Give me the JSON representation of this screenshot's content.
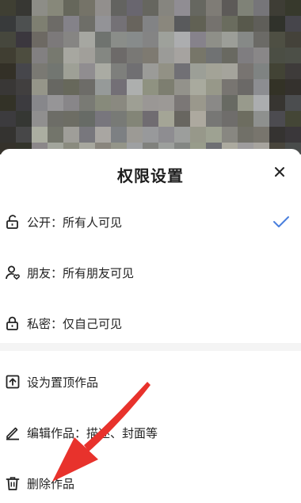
{
  "sheet": {
    "title": "权限设置"
  },
  "visibility_options": [
    {
      "label": "公开：所有人可见",
      "icon": "unlock-icon",
      "selected": true
    },
    {
      "label": "朋友：所有朋友可见",
      "icon": "friends-icon",
      "selected": false
    },
    {
      "label": "私密：仅自己可见",
      "icon": "lock-icon",
      "selected": false
    }
  ],
  "actions": [
    {
      "label": "设为置顶作品",
      "icon": "pin-top-icon"
    },
    {
      "label": "编辑作品：描述、封面等",
      "icon": "edit-pen-icon"
    },
    {
      "label": "删除作品",
      "icon": "trash-icon"
    }
  ],
  "colors": {
    "check_accent": "#4a7fdd",
    "annotation_arrow": "#e8322c"
  }
}
